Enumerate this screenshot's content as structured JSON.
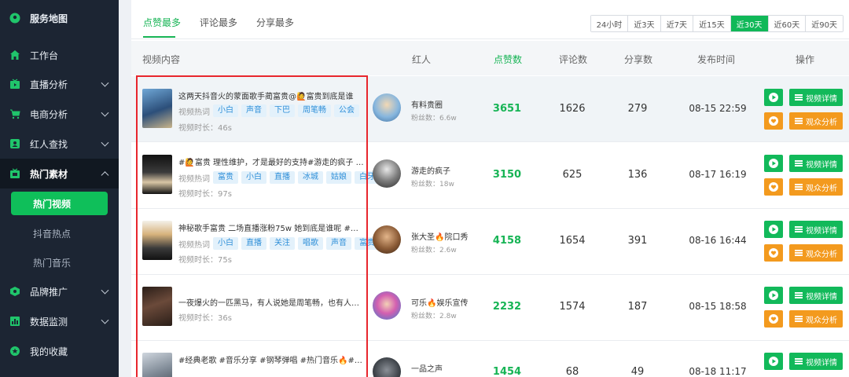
{
  "sidebar": {
    "brand": "服务地图",
    "items": [
      {
        "label": "工作台",
        "icon": "home-icon"
      },
      {
        "label": "直播分析",
        "icon": "live-tv-icon"
      },
      {
        "label": "电商分析",
        "icon": "cart-icon"
      },
      {
        "label": "红人查找",
        "icon": "search-person-icon"
      },
      {
        "label": "热门素材",
        "icon": "material-icon"
      },
      {
        "label": "品牌推广",
        "icon": "brand-icon"
      },
      {
        "label": "数据监测",
        "icon": "chart-icon"
      },
      {
        "label": "我的收藏",
        "icon": "star-icon"
      }
    ],
    "sub_items": [
      "热门视频",
      "抖音热点",
      "热门音乐"
    ]
  },
  "tabs": [
    "点赞最多",
    "评论最多",
    "分享最多"
  ],
  "ranges": [
    "24小时",
    "近3天",
    "近7天",
    "近15天",
    "近30天",
    "近60天",
    "近90天"
  ],
  "active_range": "近30天",
  "columns": {
    "video": "视频内容",
    "kol": "红人",
    "likes": "点赞数",
    "comments": "评论数",
    "shares": "分享数",
    "time": "发布时间",
    "actions": "操作"
  },
  "labels": {
    "hot_words": "视频热词",
    "duration_prefix": "视频时长：",
    "fans_prefix": "粉丝数：",
    "detail_btn": "视频详情",
    "audience_btn": "观众分析"
  },
  "rows": [
    {
      "title": "这两天抖音火的蒙面歌手蔺富贵@🙋富贵到底是谁",
      "tags": [
        "小白",
        "声音",
        "下巴",
        "周笔畅",
        "公会"
      ],
      "duration": "46s",
      "kol_name": "有料贵圈",
      "fans": "6.6w",
      "likes": "3651",
      "comments": "1626",
      "shares": "279",
      "time": "08-15 22:59"
    },
    {
      "title": "#🙋富贵 理性维护，才是最好的支持#游走的疯子 …",
      "tags": [
        "富贵",
        "小白",
        "直播",
        "冰城",
        "姑娘",
        "白牙"
      ],
      "duration": "97s",
      "kol_name": "游走的疯子",
      "fans": "18w",
      "likes": "3150",
      "comments": "625",
      "shares": "136",
      "time": "08-17 16:19"
    },
    {
      "title": "神秘歌手富贵 二场直播涨粉75w 她到底是谁呢 #…",
      "tags": [
        "小白",
        "直播",
        "关注",
        "唱歌",
        "声音",
        "富贵"
      ],
      "duration": "75s",
      "kol_name": "张大圣🔥院口秀",
      "fans": "2.6w",
      "likes": "4158",
      "comments": "1654",
      "shares": "391",
      "time": "08-16 16:44"
    },
    {
      "title": "一夜爆火的一匹黑马，有人说她是周笔畅，也有人…",
      "tags": [],
      "duration": "36s",
      "kol_name": "可乐🔥娱乐宣传",
      "fans": "2.8w",
      "likes": "2232",
      "comments": "1574",
      "shares": "187",
      "time": "08-15 18:58"
    },
    {
      "title": "#经典老歌 #音乐分享 #钢琴弹唱 #热门音乐🔥#…",
      "tags": [],
      "duration": "",
      "kol_name": "一品之声",
      "fans": "",
      "likes": "1454",
      "comments": "68",
      "shares": "49",
      "time": "08-18 11:17"
    }
  ]
}
